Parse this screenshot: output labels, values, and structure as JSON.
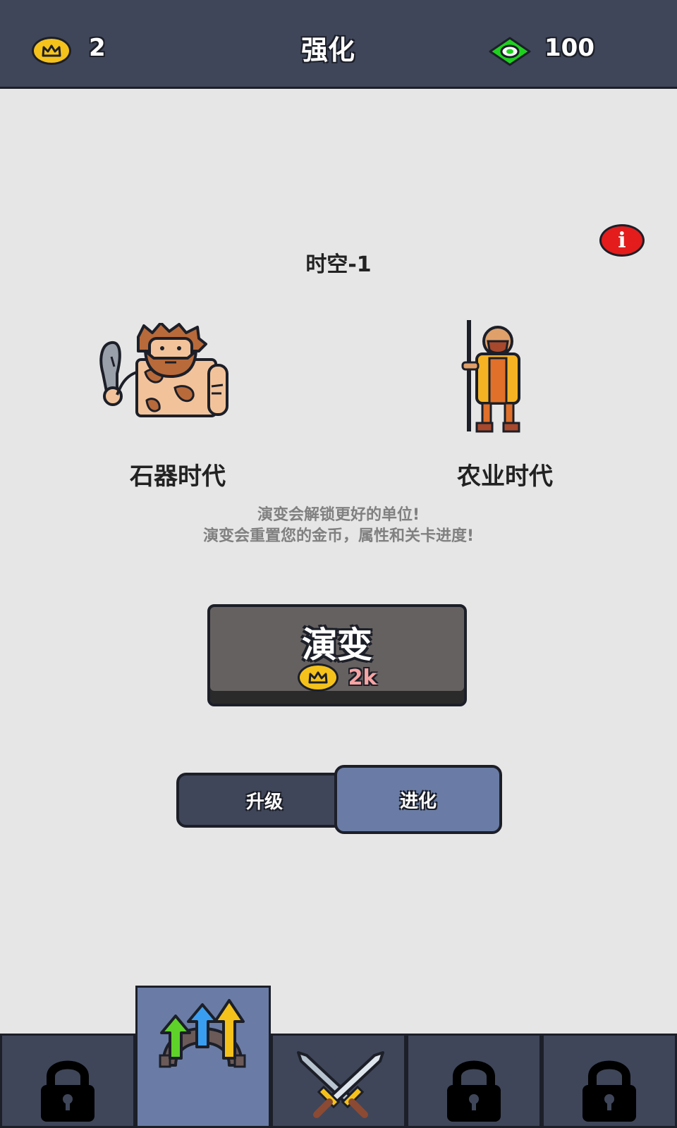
{
  "header": {
    "crowns": "2",
    "title": "强化",
    "gems": "100"
  },
  "main": {
    "era": "时空-1",
    "current_unit": "石器时代",
    "next_unit": "农业时代",
    "desc_line1": "演变会解锁更好的单位!",
    "desc_line2": "演变会重置您的金币，属性和关卡进度!",
    "evolve_button": {
      "label": "演变",
      "cost": "2k"
    }
  },
  "tabs": {
    "upgrade": "升级",
    "evolve": "进化"
  },
  "bottom_nav": {
    "items": [
      {
        "icon": "lock-icon",
        "locked": true
      },
      {
        "icon": "upgrade-arrows-icon",
        "active": true
      },
      {
        "icon": "crossed-swords-icon"
      },
      {
        "icon": "lock-icon",
        "locked": true
      },
      {
        "icon": "lock-icon",
        "locked": true
      }
    ]
  },
  "colors": {
    "topbar": "#3f4659",
    "active_tab": "#6a7ca5",
    "coin": "#f5c21b",
    "gem": "#1fd11f",
    "info": "#e41c1c"
  }
}
